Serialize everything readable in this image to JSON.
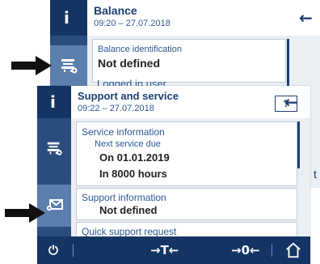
{
  "back_screen": {
    "title": "Balance",
    "timestamp": "09:20 – 27.07.2018",
    "field": {
      "label": "Balance identification",
      "value": "Not defined"
    },
    "next_item": "Logged in user",
    "edge_char": "t",
    "info_icon": "i",
    "back_icon": "←"
  },
  "front_screen": {
    "title": "Support and service",
    "timestamp": "09:22 – 27.07.2018",
    "help_label": "?",
    "info_icon": "i",
    "back_icon": "←",
    "service_info": {
      "title": "Service information",
      "next_label": "Next service due",
      "date": "On 01.01.2019",
      "hours": "In 8000 hours"
    },
    "support_info": {
      "title": "Support information",
      "value": "Not defined"
    },
    "quick_support": "Quick support request"
  },
  "footer": {
    "power_icon": "⏻",
    "tare_label": "→T←",
    "zero_label": "→0←",
    "home_icon": "home"
  },
  "colors": {
    "sidebar": "#2a4d7e",
    "header_active": "#143564",
    "selected_tile": "#5c80ad",
    "accent_text": "#1d3f74"
  }
}
